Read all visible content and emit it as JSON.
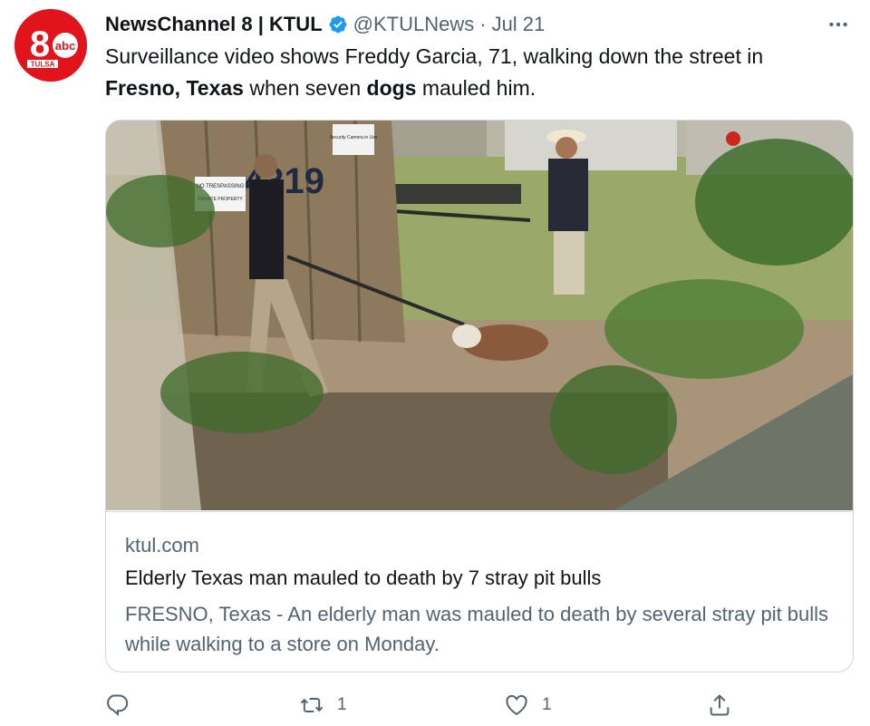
{
  "author": {
    "display_name": "NewsChannel 8 | KTUL",
    "handle": "@KTULNews",
    "separator": "·",
    "date": "Jul 21",
    "avatar": {
      "logo_number": "8",
      "logo_text": "abc",
      "logo_city": "TULSA"
    }
  },
  "tweet": {
    "text_line1": "Surveillance video shows Freddy Garcia, 71, walking down the street in",
    "text_bold1": "Fresno, Texas",
    "text_mid": " when seven ",
    "text_bold2": "dogs",
    "text_end": " mauled him."
  },
  "card": {
    "image_signs": {
      "no_trespassing": "NO TRESPASSING",
      "private_property": "PRIVATE PROPERTY",
      "house_number": "4319",
      "security": "Security Camera in Use"
    },
    "domain": "ktul.com",
    "title": "Elderly Texas man mauled to death by 7 stray pit bulls",
    "description": "FRESNO, Texas - An elderly man was mauled to death by several stray pit bulls while walking to a store on Monday."
  },
  "actions": {
    "reply": {
      "icon": "reply-icon"
    },
    "retweet": {
      "icon": "retweet-icon",
      "count": "1"
    },
    "like": {
      "icon": "heart-icon",
      "count": "1"
    },
    "share": {
      "icon": "share-icon"
    }
  },
  "colors": {
    "brand_red": "#e1141b",
    "verified_blue": "#1d9bf0",
    "secondary_text": "#536471"
  }
}
